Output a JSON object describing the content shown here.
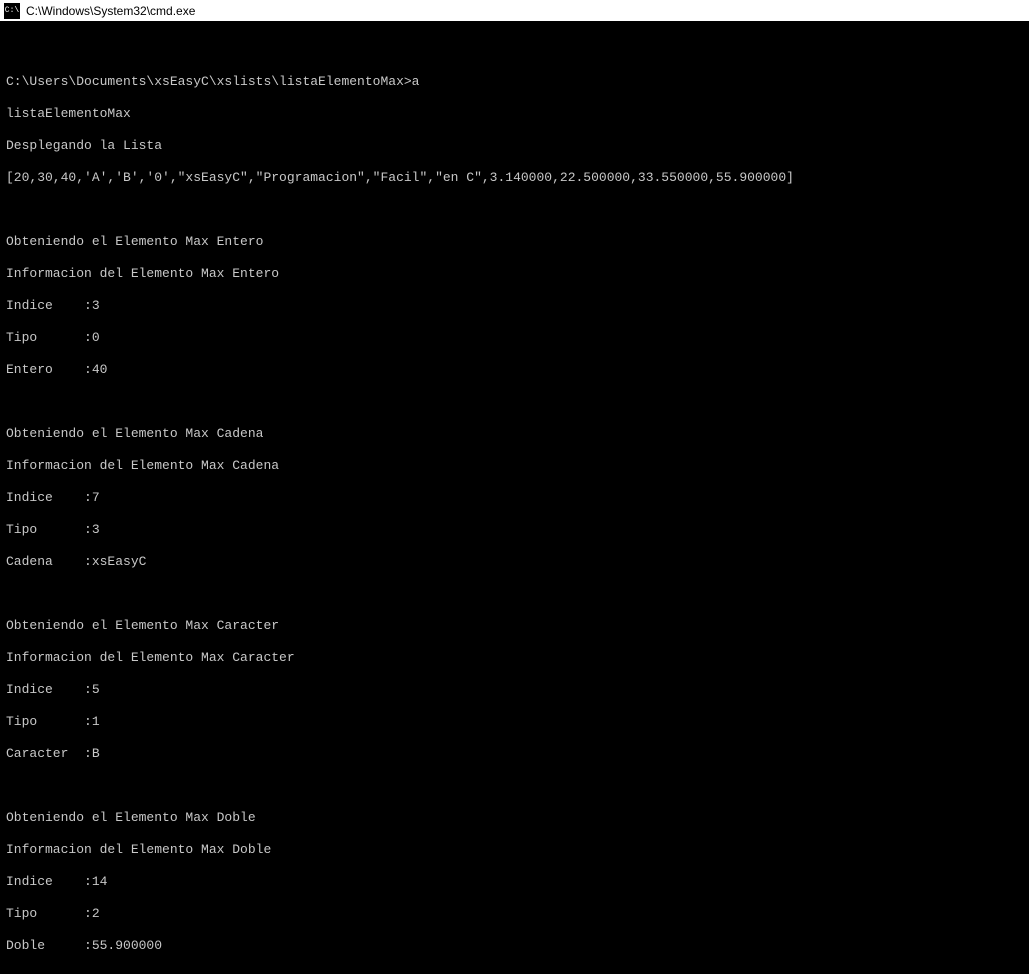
{
  "titlebar": {
    "icon_label": "C:\\",
    "title": "C:\\Windows\\System32\\cmd.exe"
  },
  "terminal": {
    "line01": "",
    "line02": "C:\\Users\\Documents\\xsEasyC\\xslists\\listaElementoMax>a",
    "line03": "listaElementoMax",
    "line04": "Desplegando la Lista",
    "line05": "[20,30,40,'A','B','0',\"xsEasyC\",\"Programacion\",\"Facil\",\"en C\",3.140000,22.500000,33.550000,55.900000]",
    "line06": "",
    "line07": "Obteniendo el Elemento Max Entero",
    "line08": "Informacion del Elemento Max Entero",
    "line09": "Indice    :3",
    "line10": "Tipo      :0",
    "line11": "Entero    :40",
    "line12": "",
    "line13": "Obteniendo el Elemento Max Cadena",
    "line14": "Informacion del Elemento Max Cadena",
    "line15": "Indice    :7",
    "line16": "Tipo      :3",
    "line17": "Cadena    :xsEasyC",
    "line18": "",
    "line19": "Obteniendo el Elemento Max Caracter",
    "line20": "Informacion del Elemento Max Caracter",
    "line21": "Indice    :5",
    "line22": "Tipo      :1",
    "line23": "Caracter  :B",
    "line24": "",
    "line25": "Obteniendo el Elemento Max Doble",
    "line26": "Informacion del Elemento Max Doble",
    "line27": "Indice    :14",
    "line28": "Tipo      :2",
    "line29": "Doble     :55.900000"
  }
}
